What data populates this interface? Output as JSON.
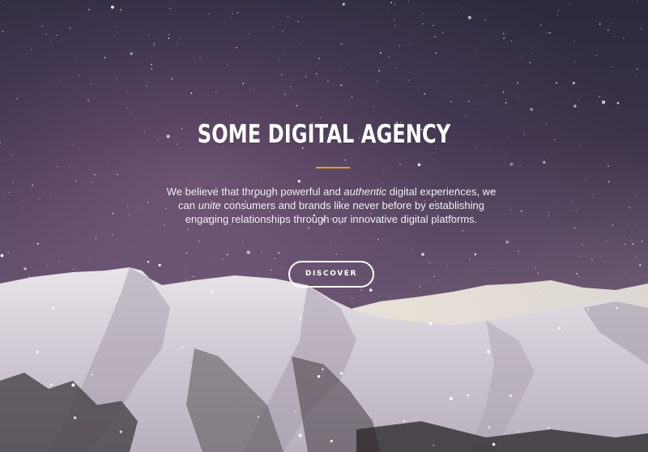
{
  "hero": {
    "title": "SOME DIGITAL AGENCY",
    "accent_color": "#e0a020",
    "description": {
      "part1": "We believe that through powerful and ",
      "em1": "authentic",
      "part2": " digital experiences, we can ",
      "em2": "unite",
      "part3": " consumers and brands like never before by establishing engaging relationships through our innovative digital platforms."
    },
    "cta_label": "DISCOVER"
  }
}
